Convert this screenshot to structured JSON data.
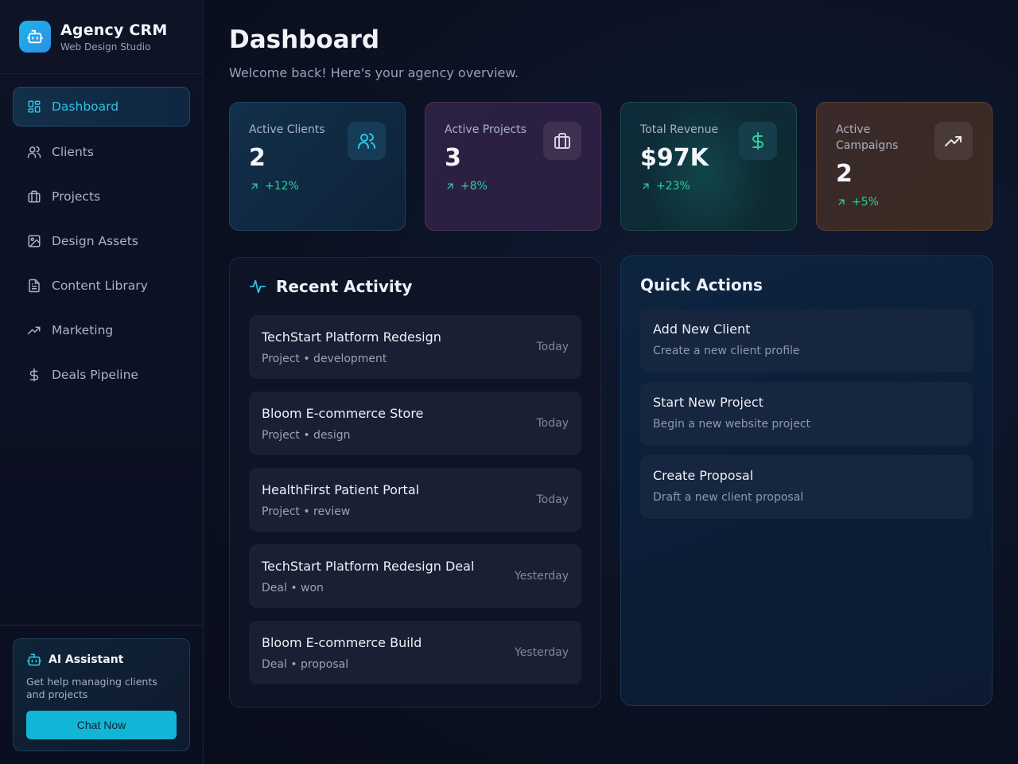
{
  "brand": {
    "title": "Agency CRM",
    "subtitle": "Web Design Studio",
    "logo_icon": "robot-icon"
  },
  "sidebar": {
    "items": [
      {
        "label": "Dashboard",
        "icon": "dashboard-grid-icon",
        "active": true
      },
      {
        "label": "Clients",
        "icon": "users-icon"
      },
      {
        "label": "Projects",
        "icon": "briefcase-icon"
      },
      {
        "label": "Design Assets",
        "icon": "image-icon"
      },
      {
        "label": "Content Library",
        "icon": "document-icon"
      },
      {
        "label": "Marketing",
        "icon": "trending-up-icon"
      },
      {
        "label": "Deals Pipeline",
        "icon": "dollar-icon"
      }
    ],
    "assistant": {
      "title": "AI Assistant",
      "description": "Get help managing clients and projects",
      "button": "Chat Now"
    }
  },
  "header": {
    "title": "Dashboard",
    "subtitle": "Welcome back! Here's your agency overview."
  },
  "stats": [
    {
      "label": "Active Clients",
      "value": "2",
      "change": "+12%",
      "icon": "users-icon",
      "accent": "#2cc4e4"
    },
    {
      "label": "Active Projects",
      "value": "3",
      "change": "+8%",
      "icon": "briefcase-icon",
      "accent": "#c9c4d8"
    },
    {
      "label": "Total Revenue",
      "value": "$97K",
      "change": "+23%",
      "icon": "dollar-icon",
      "accent": "#2dcf9f"
    },
    {
      "label": "Active Campaigns",
      "value": "2",
      "change": "+5%",
      "icon": "trending-up-icon",
      "accent": "#e4ddd6"
    }
  ],
  "activity": {
    "title": "Recent Activity",
    "items": [
      {
        "name": "TechStart Platform Redesign",
        "meta": "Project • development",
        "when": "Today"
      },
      {
        "name": "Bloom E-commerce Store",
        "meta": "Project • design",
        "when": "Today"
      },
      {
        "name": "HealthFirst Patient Portal",
        "meta": "Project • review",
        "when": "Today"
      },
      {
        "name": "TechStart Platform Redesign Deal",
        "meta": "Deal • won",
        "when": "Yesterday"
      },
      {
        "name": "Bloom E-commerce Build",
        "meta": "Deal • proposal",
        "when": "Yesterday"
      }
    ]
  },
  "quick_actions": {
    "title": "Quick Actions",
    "items": [
      {
        "title": "Add New Client",
        "description": "Create a new client profile"
      },
      {
        "title": "Start New Project",
        "description": "Begin a new website project"
      },
      {
        "title": "Create Proposal",
        "description": "Draft a new client proposal"
      }
    ]
  },
  "colors": {
    "accent": "#11b5d6",
    "positive": "#2dcf9f",
    "background": "#0b1020"
  }
}
